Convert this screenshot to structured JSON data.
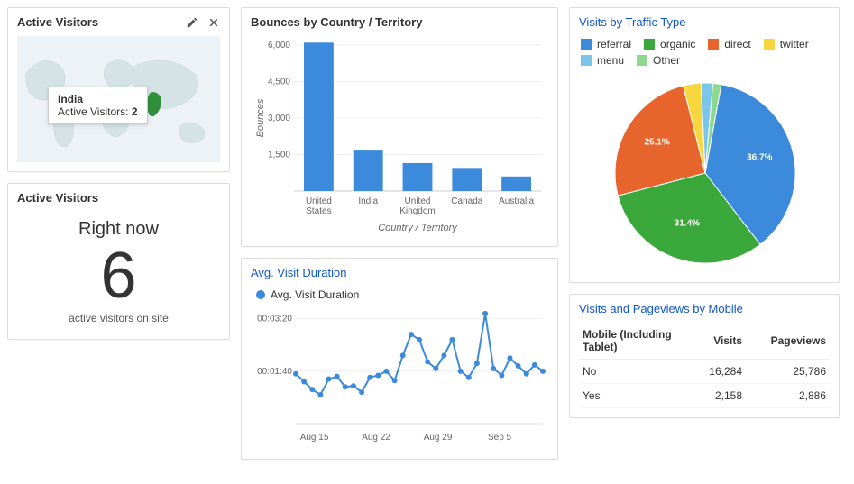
{
  "colors": {
    "blue": "#3b8adb",
    "green": "#3aa83a",
    "orange": "#e8642d",
    "yellow": "#f7d63e",
    "cyan": "#7ac6e8",
    "lightgreen": "#8fd98f",
    "link": "#1155cc",
    "map_land": "#d5e3e6",
    "map_highlight": "#2f8f3a"
  },
  "active_visitors_map": {
    "title": "Active Visitors",
    "tooltip_country": "India",
    "tooltip_label": "Active Visitors:",
    "tooltip_value": "2"
  },
  "active_visitors_now": {
    "title": "Active Visitors",
    "right_now": "Right now",
    "count": "6",
    "subtext": "active visitors on site"
  },
  "bounces": {
    "title": "Bounces by Country / Territory",
    "ylabel": "Bounces",
    "xlabel": "Country / Territory"
  },
  "avg_duration": {
    "title": "Avg. Visit Duration",
    "series_label": "Avg. Visit Duration",
    "y_ticks": [
      "00:01:40",
      "00:03:20"
    ],
    "x_ticks": [
      "Aug 15",
      "Aug 22",
      "Aug 29",
      "Sep 5"
    ]
  },
  "traffic_type": {
    "title": "Visits by Traffic Type",
    "legend": [
      "referral",
      "organic",
      "direct",
      "twitter",
      "menu",
      "Other"
    ],
    "slice_labels": [
      "36.7%",
      "31.4%",
      "25.1%"
    ]
  },
  "mobile_table": {
    "title": "Visits and Pageviews by Mobile",
    "headers": [
      "Mobile (Including Tablet)",
      "Visits",
      "Pageviews"
    ],
    "rows": [
      [
        "No",
        "16,284",
        "25,786"
      ],
      [
        "Yes",
        "2,158",
        "2,886"
      ]
    ]
  },
  "chart_data": [
    {
      "type": "bar",
      "title": "Bounces by Country / Territory",
      "xlabel": "Country / Territory",
      "ylabel": "Bounces",
      "ylim": [
        0,
        6000
      ],
      "categories": [
        "United States",
        "India",
        "United Kingdom",
        "Canada",
        "Australia"
      ],
      "values": [
        6100,
        1700,
        1150,
        950,
        600
      ]
    },
    {
      "type": "line",
      "title": "Avg. Visit Duration",
      "series": [
        {
          "name": "Avg. Visit Duration",
          "values_seconds": [
            95,
            80,
            65,
            55,
            85,
            90,
            70,
            72,
            60,
            88,
            92,
            100,
            82,
            130,
            170,
            160,
            118,
            105,
            130,
            160,
            100,
            88,
            115,
            210,
            105,
            92,
            125,
            110,
            95,
            112,
            100
          ]
        }
      ],
      "x": [
        "Aug 13",
        "Aug 14",
        "Aug 15",
        "Aug 16",
        "Aug 17",
        "Aug 18",
        "Aug 19",
        "Aug 20",
        "Aug 21",
        "Aug 22",
        "Aug 23",
        "Aug 24",
        "Aug 25",
        "Aug 26",
        "Aug 27",
        "Aug 28",
        "Aug 29",
        "Aug 30",
        "Aug 31",
        "Sep 1",
        "Sep 2",
        "Sep 3",
        "Sep 4",
        "Sep 5",
        "Sep 6",
        "Sep 7",
        "Sep 8",
        "Sep 9",
        "Sep 10",
        "Sep 11",
        "Sep 12"
      ],
      "ylim_seconds": [
        0,
        220
      ],
      "y_tick_seconds": [
        100,
        200
      ],
      "y_tick_labels": [
        "00:01:40",
        "00:03:20"
      ],
      "x_tick_labels": [
        "Aug 15",
        "Aug 22",
        "Aug 29",
        "Sep 5"
      ]
    },
    {
      "type": "pie",
      "title": "Visits by Traffic Type",
      "series": [
        {
          "name": "referral",
          "value": 36.7,
          "color": "#3b8adb"
        },
        {
          "name": "organic",
          "value": 31.4,
          "color": "#3aa83a"
        },
        {
          "name": "direct",
          "value": 25.1,
          "color": "#e8642d"
        },
        {
          "name": "twitter",
          "value": 3.2,
          "color": "#f7d63e"
        },
        {
          "name": "menu",
          "value": 2.1,
          "color": "#7ac6e8"
        },
        {
          "name": "Other",
          "value": 1.5,
          "color": "#8fd98f"
        }
      ]
    },
    {
      "type": "table",
      "title": "Visits and Pageviews by Mobile",
      "columns": [
        "Mobile (Including Tablet)",
        "Visits",
        "Pageviews"
      ],
      "rows": [
        {
          "Mobile (Including Tablet)": "No",
          "Visits": 16284,
          "Pageviews": 25786
        },
        {
          "Mobile (Including Tablet)": "Yes",
          "Visits": 2158,
          "Pageviews": 2886
        }
      ]
    }
  ]
}
